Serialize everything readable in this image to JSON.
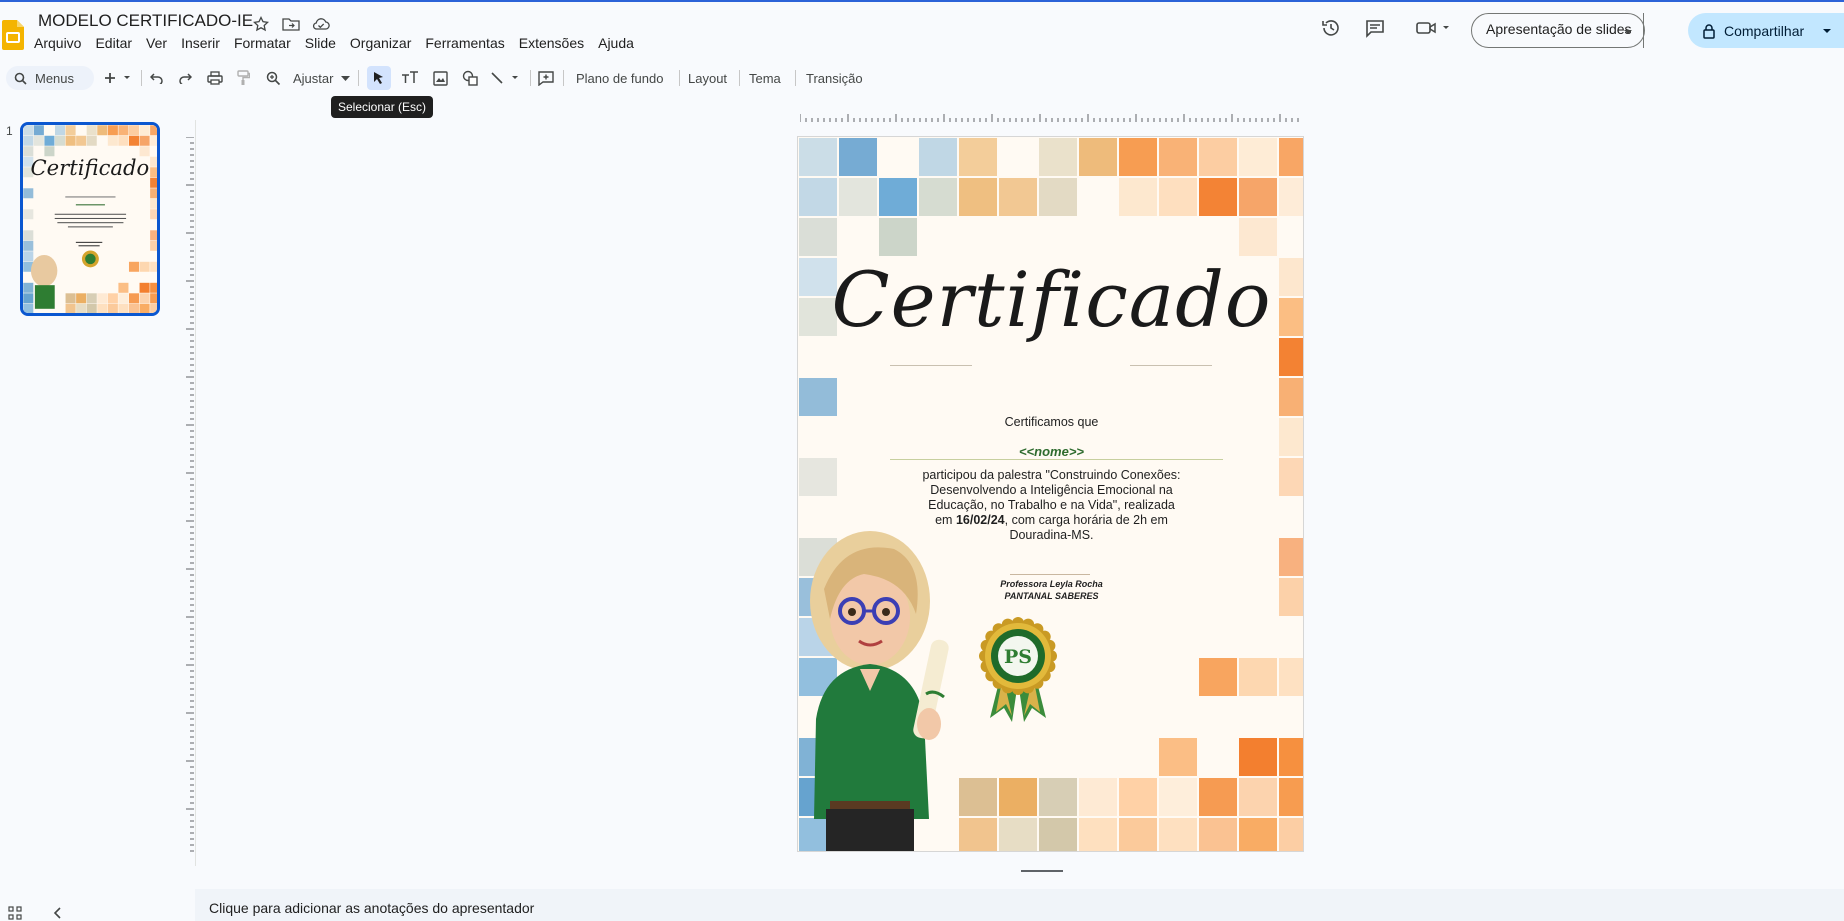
{
  "app": {
    "title": "MODELO CERTIFICADO-IE"
  },
  "menu": [
    "Arquivo",
    "Editar",
    "Ver",
    "Inserir",
    "Formatar",
    "Slide",
    "Organizar",
    "Ferramentas",
    "Extensões",
    "Ajuda"
  ],
  "header": {
    "present_label": "Apresentação de slides",
    "share_label": "Compartilhar"
  },
  "toolbar": {
    "search_label": "Menus",
    "zoom_label": "Ajustar",
    "background_label": "Plano de fundo",
    "layout_label": "Layout",
    "theme_label": "Tema",
    "transition_label": "Transição",
    "tooltip": "Selecionar (Esc)"
  },
  "filmstrip": {
    "slide_number": "1"
  },
  "slide": {
    "title": "Certificado",
    "intro": "Certificamos que",
    "name_placeholder": "<<nome>>",
    "body_line1": "participou da palestra \"Construindo Conexões: Desenvolvendo a Inteligência Emocional na Educação, no Trabalho e na Vida\", realizada em",
    "body_date": "16/02/24",
    "body_line2": ", com carga horária de 2h em Douradina-MS.",
    "signer_name": "Professora Leyla Rocha",
    "signer_org": "PANTANAL SABERES",
    "seal_text": "PS"
  },
  "notes": {
    "placeholder": "Clique para adicionar as anotações do apresentador"
  },
  "colors": {
    "accent": "#0b57d0",
    "share_bg": "#c2e7ff",
    "logo_yellow": "#f4b400",
    "name_green": "#2e6b2e",
    "tile_blue": "#5aa0d0",
    "tile_orange": "#f07a22"
  }
}
